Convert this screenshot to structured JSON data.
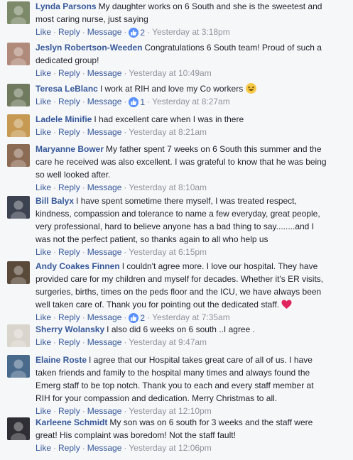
{
  "comments": [
    {
      "author": "Lynda Parsons",
      "text": "My daughter works on 6 South and she is the sweetest and most caring nurse, just saying",
      "likes": "2",
      "time": "Yesterday at 3:18pm",
      "avatar_color": "#7d8a6a"
    },
    {
      "author": "Jeslyn Robertson-Weeden",
      "text": "Congratulations 6 South team! Proud of such a dedicated group!",
      "time": "Yesterday at 10:49am",
      "avatar_color": "#b08a7a"
    },
    {
      "author": "Teresa LeBlanc",
      "text": "I work at RIH and love my Co workers",
      "emoji": "laughing-emoji",
      "likes": "1",
      "time": "Yesterday at 8:27am",
      "avatar_color": "#6f7a5e"
    },
    {
      "author": "Ladele Minifie",
      "text": "I had excellent care when I was in there",
      "time": "Yesterday at 8:21am",
      "avatar_color": "#c69a52"
    },
    {
      "author": "Maryanne Bower",
      "text": "My father spent 7 weeks on 6 South this summer and the care he received was also excellent. I was grateful to know that he was being so well looked after.",
      "time": "Yesterday at 8:10am",
      "avatar_color": "#8c6b55"
    },
    {
      "author": "Bill Balyx",
      "text": "I have spent sometime there myself, I was treated respect, kindness, compassion and tolerance to name a few everyday, great people, very professional, hard to believe anyone has a bad thing to say........and I was not the perfect patient, so thanks again to all who help us",
      "time": "Yesterday at 6:15pm",
      "avatar_color": "#3d4250"
    },
    {
      "author": "Andy Coakes Finnen",
      "text": "I couldn't agree more. I love our hospital. They have provided care for my children and myself for decades. Whether it's ER visits, surgeries, births, times on the peds floor and the ICU, we have always been well taken care of. Thank you for pointing out the dedicated staff.",
      "emoji": "heart-emoji",
      "likes": "2",
      "time": "Yesterday at 7:35am",
      "avatar_color": "#5a4a3a"
    },
    {
      "author": "Sherry Wolansky",
      "text": "I also did 6 weeks on 6 south ..I agree .",
      "time": "Yesterday at 9:47am",
      "avatar_color": "#d9d4cc"
    },
    {
      "author": "Elaine Roste",
      "text": "I agree that our Hospital takes great care of all of us. I have taken friends and family to the hospital many times and always found the Emerg staff to be top notch. Thank you to each and every staff member at RIH for your compassion and dedication. Merry Christmas to all.",
      "time": "Yesterday at 12:10pm",
      "avatar_color": "#4a6a8c"
    },
    {
      "author": "Karleene Schmidt",
      "text": "My son was on 6 south for 3 weeks and the staff were great! His complaint was boredom! Not the staff fault!",
      "time": "Yesterday at 12:06pm",
      "avatar_color": "#2e2e34"
    }
  ],
  "actions": {
    "like": "Like",
    "reply": "Reply",
    "message": "Message",
    "separator": "·"
  },
  "colors": {
    "link": "#365899",
    "meta": "#90949c",
    "like_badge": "#5890ff",
    "heart": "#e0245e"
  }
}
